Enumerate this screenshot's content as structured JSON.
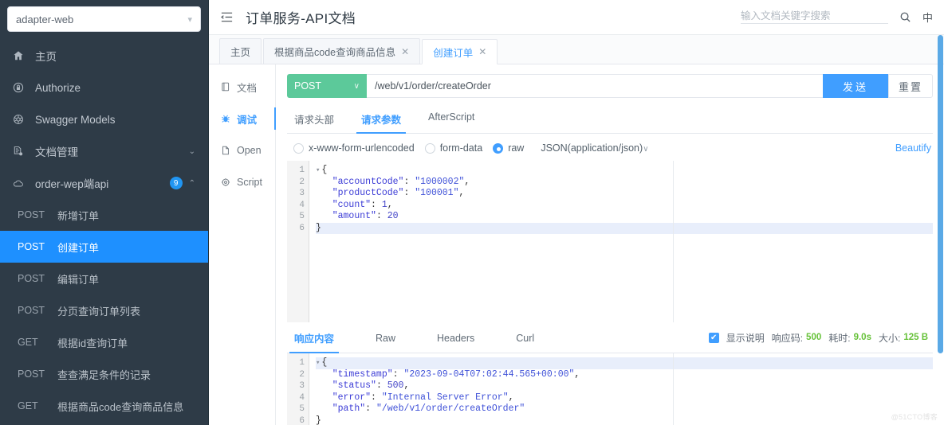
{
  "sidebar": {
    "project": {
      "name": "adapter-web",
      "caret_icon": "chevron-down-icon"
    },
    "nav": [
      {
        "label": "主页",
        "icon": "home-icon"
      },
      {
        "label": "Authorize",
        "icon": "lock-icon"
      },
      {
        "label": "Swagger Models",
        "icon": "model-icon"
      },
      {
        "label": "文档管理",
        "icon": "document-settings-icon",
        "chev": "⌄"
      },
      {
        "label": "order-wep端api",
        "icon": "cloud-icon",
        "badge": "9",
        "chev": "⌃"
      }
    ],
    "apis": [
      {
        "method": "POST",
        "label": "新增订单",
        "active": false
      },
      {
        "method": "POST",
        "label": "创建订单",
        "active": true
      },
      {
        "method": "POST",
        "label": "编辑订单",
        "active": false
      },
      {
        "method": "POST",
        "label": "分页查询订单列表",
        "active": false
      },
      {
        "method": "GET",
        "label": "根据id查询订单",
        "active": false
      },
      {
        "method": "POST",
        "label": "查查满足条件的记录",
        "active": false
      },
      {
        "method": "GET",
        "label": "根据商品code查询商品信息",
        "active": false
      }
    ]
  },
  "topbar": {
    "collapse_icon": "collapse-menu-icon",
    "title": "订单服务-API文档",
    "search": {
      "placeholder": "输入文档关键字搜索",
      "value": "",
      "icon": "search-icon"
    },
    "lang": "中"
  },
  "tabs": [
    {
      "label": "主页",
      "closable": false,
      "active": false
    },
    {
      "label": "根据商品code查询商品信息",
      "closable": true,
      "active": false,
      "close": "✕"
    },
    {
      "label": "创建订单",
      "closable": true,
      "active": true,
      "close": "✕"
    }
  ],
  "mininav": [
    {
      "label": "文档",
      "icon": "doc-icon",
      "active": false
    },
    {
      "label": "调试",
      "icon": "bug-icon",
      "active": true
    },
    {
      "label": "Open",
      "icon": "open-file-icon",
      "active": false
    },
    {
      "label": "Script",
      "icon": "script-gear-icon",
      "active": false
    }
  ],
  "request": {
    "method": "POST",
    "method_caret": "∨",
    "url": "/web/v1/order/createOrder",
    "send_label": "发送",
    "reset_label": "重置",
    "subtabs": [
      {
        "label": "请求头部",
        "active": false
      },
      {
        "label": "请求参数",
        "active": true
      },
      {
        "label": "AfterScript",
        "active": false
      }
    ],
    "body_modes": [
      {
        "label": "x-www-form-urlencoded",
        "selected": false
      },
      {
        "label": "form-data",
        "selected": false
      },
      {
        "label": "raw",
        "selected": true
      }
    ],
    "content_type": "JSON(application/json)",
    "content_type_caret": "∨",
    "beautify_label": "Beautify",
    "code_lines": [
      "1",
      "2",
      "3",
      "4",
      "5",
      "6"
    ],
    "body": {
      "accountCode": "1000002",
      "productCode": "100001",
      "count": "1",
      "amount": "20"
    }
  },
  "response": {
    "tabs": [
      {
        "label": "响应内容",
        "active": true
      },
      {
        "label": "Raw",
        "active": false
      },
      {
        "label": "Headers",
        "active": false
      },
      {
        "label": "Curl",
        "active": false
      }
    ],
    "show_desc_label": "显示说明",
    "show_desc_checked": true,
    "check_glyph": "✔",
    "status_label": "响应码:",
    "status_value": "500",
    "time_label": "耗时:",
    "time_value": "9.0s",
    "size_label": "大小:",
    "size_value": "125 B",
    "code_lines": [
      "1",
      "2",
      "3",
      "4",
      "5",
      "6"
    ],
    "body": {
      "timestamp": "2023-09-04T07:02:44.565+00:00",
      "status": "500",
      "error": "Internal Server Error",
      "path": "/web/v1/order/createOrder"
    }
  },
  "watermark": "@51CTO博客",
  "colors": {
    "sidebar_bg": "#2e3b47",
    "active_blue": "#1e90ff",
    "accent_blue": "#409eff",
    "method_green": "#5cc99a",
    "status_green": "#67c23a"
  }
}
